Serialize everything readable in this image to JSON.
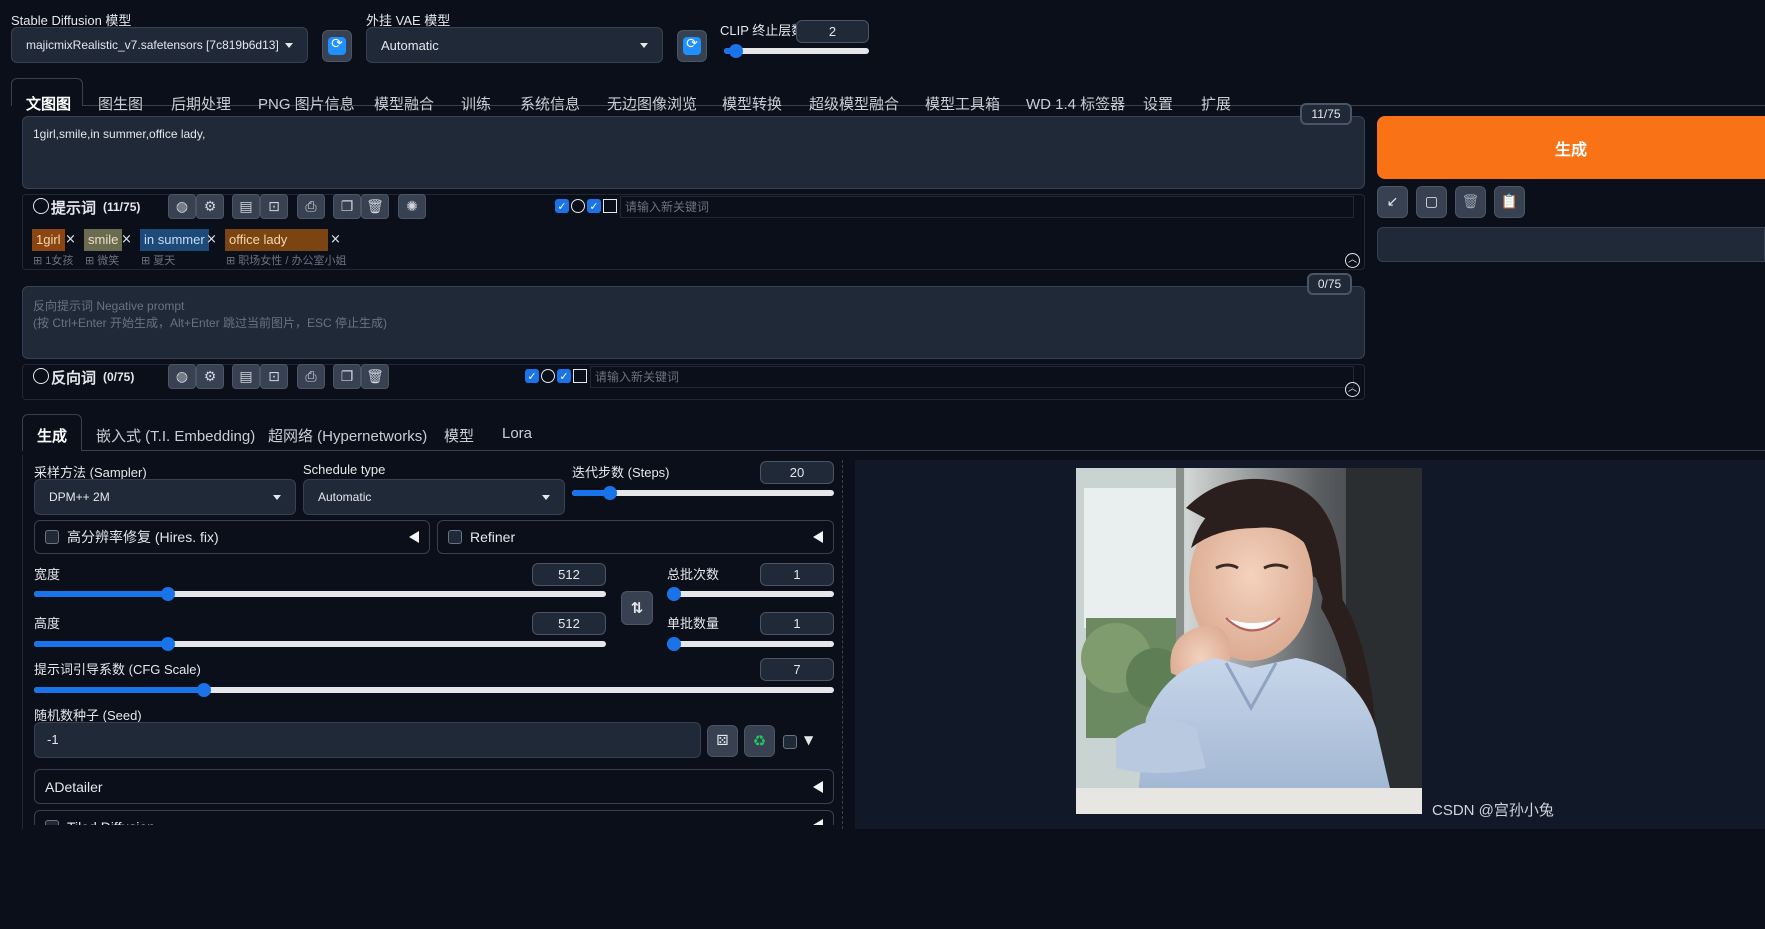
{
  "header": {
    "sd_model_label": "Stable Diffusion 模型",
    "sd_model_value": "majicmixRealistic_v7.safetensors [7c819b6d13]",
    "vae_label": "外挂 VAE 模型",
    "vae_value": "Automatic",
    "clip_label": "CLIP 终止层数",
    "clip_value": "2",
    "clip_fraction": 0.08
  },
  "main_tabs": [
    "文图图",
    "图生图",
    "后期处理",
    "PNG 图片信息",
    "模型融合",
    "训练",
    "系统信息",
    "无边图像浏览",
    "模型转换",
    "超级模型融合",
    "模型工具箱",
    "WD 1.4 标签器",
    "设置",
    "扩展"
  ],
  "prompt": {
    "text": "1girl,smile,in summer,office lady,",
    "token_count": "11/75",
    "section_label": "提示词",
    "section_count": "(11/75)",
    "keyword_placeholder": "请输入新关键词",
    "tags": [
      {
        "label": "1girl",
        "sub": "1女孩"
      },
      {
        "label": "smile",
        "sub": "微笑"
      },
      {
        "label": "in summer",
        "sub": "夏天"
      },
      {
        "label": "office lady",
        "sub": "职场女性 / 办公室小姐"
      }
    ],
    "tag_close": "×"
  },
  "negative": {
    "placeholder_line1": "反向提示词 Negative prompt",
    "placeholder_line2": "(按 Ctrl+Enter 开始生成，Alt+Enter 跳过当前图片，ESC 停止生成)",
    "token_count": "0/75",
    "section_label": "反向词",
    "section_count": "(0/75)",
    "keyword_placeholder": "请输入新关键词"
  },
  "generate": {
    "button_label": "生成"
  },
  "sub_tabs": [
    "生成",
    "嵌入式 (T.I. Embedding)",
    "超网络 (Hypernetworks)",
    "模型",
    "Lora"
  ],
  "params": {
    "sampler_label": "采样方法 (Sampler)",
    "sampler_value": "DPM++ 2M",
    "schedule_label": "Schedule type",
    "schedule_value": "Automatic",
    "steps_label": "迭代步数 (Steps)",
    "steps_value": "20",
    "steps_fraction": 0.146,
    "hires_label": "高分辨率修复 (Hires. fix)",
    "refiner_label": "Refiner",
    "width_label": "宽度",
    "width_value": "512",
    "width_fraction": 0.234,
    "height_label": "高度",
    "height_value": "512",
    "height_fraction": 0.234,
    "batch_count_label": "总批次数",
    "batch_count_value": "1",
    "batch_count_fraction": 0.0,
    "batch_size_label": "单批数量",
    "batch_size_value": "1",
    "batch_size_fraction": 0.0,
    "cfg_label": "提示词引导系数 (CFG Scale)",
    "cfg_value": "7",
    "cfg_fraction": 0.212,
    "seed_label": "随机数种子 (Seed)",
    "seed_value": "-1",
    "adetailer_label": "ADetailer",
    "tiled_label": "Tiled Diffusion"
  },
  "watermark": "CSDN @宫孙小兔",
  "colors": {
    "generate_bg": "#f97316",
    "accent": "#1a73e8",
    "bg": "#0b0f19"
  }
}
